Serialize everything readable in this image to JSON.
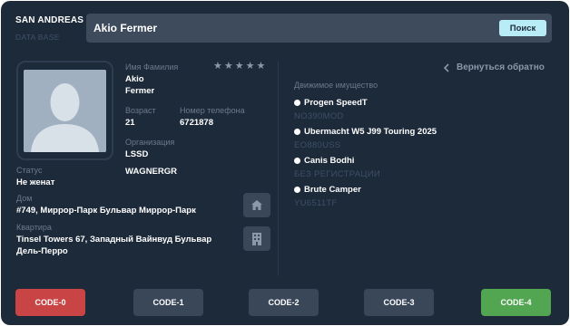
{
  "brand": {
    "title": "SAN ANDREAS",
    "subtitle": "DATA BASE"
  },
  "search": {
    "value": "Akio Fermer",
    "button_label": "Поиск"
  },
  "profile": {
    "rating_stars": 5,
    "name_label": "Имя Фамилия",
    "first_name": "Akio",
    "last_name": "Fermer",
    "age_label": "Возраст",
    "age": "21",
    "phone_label": "Номер телефона",
    "phone": "6721878",
    "org_label": "Организация",
    "org": "LSSD",
    "rank": "WAGNERGR",
    "status_label": "Статус",
    "status": "Не женат",
    "house_label": "Дом",
    "house": "#749, Миррор-Парк Бульвар Миррор-Парк",
    "apartment_label": "Квартира",
    "apartment_line1": "Tinsel Towers 67, Западный Вайнвуд Бульвар",
    "apartment_line2": "Дель-Перро"
  },
  "back_label": "Вернуться обратно",
  "vehicles_title": "Движимое имущество",
  "vehicles": [
    {
      "name": "Progen SpeedT",
      "plate": "NO390MOD"
    },
    {
      "name": "Ubermacht W5 J99 Touring 2025",
      "plate": "EO880USS"
    },
    {
      "name": "Canis Bodhi",
      "plate": "БЕЗ РЕГИСТРАЦИИ"
    },
    {
      "name": "Brute Camper",
      "plate": "YU6511TF"
    }
  ],
  "codes": [
    {
      "label": "CODE-0",
      "color": "#c94444"
    },
    {
      "label": "CODE-1",
      "color": "#3a4759"
    },
    {
      "label": "CODE-2",
      "color": "#3a4759"
    },
    {
      "label": "CODE-3",
      "color": "#3a4759"
    },
    {
      "label": "CODE-4",
      "color": "#52a551"
    }
  ],
  "colors": {
    "background": "#1d2a3a",
    "search_button": "#b8ecf7",
    "muted_label": "#6b7a8c",
    "plate_text": "#3d4f66",
    "avatar": "#a1b0c0"
  },
  "icons": {
    "rating": "star-icon",
    "back": "chevron-left-icon",
    "house": "home-icon",
    "apartment": "building-icon",
    "avatar": "user-silhouette-icon"
  }
}
